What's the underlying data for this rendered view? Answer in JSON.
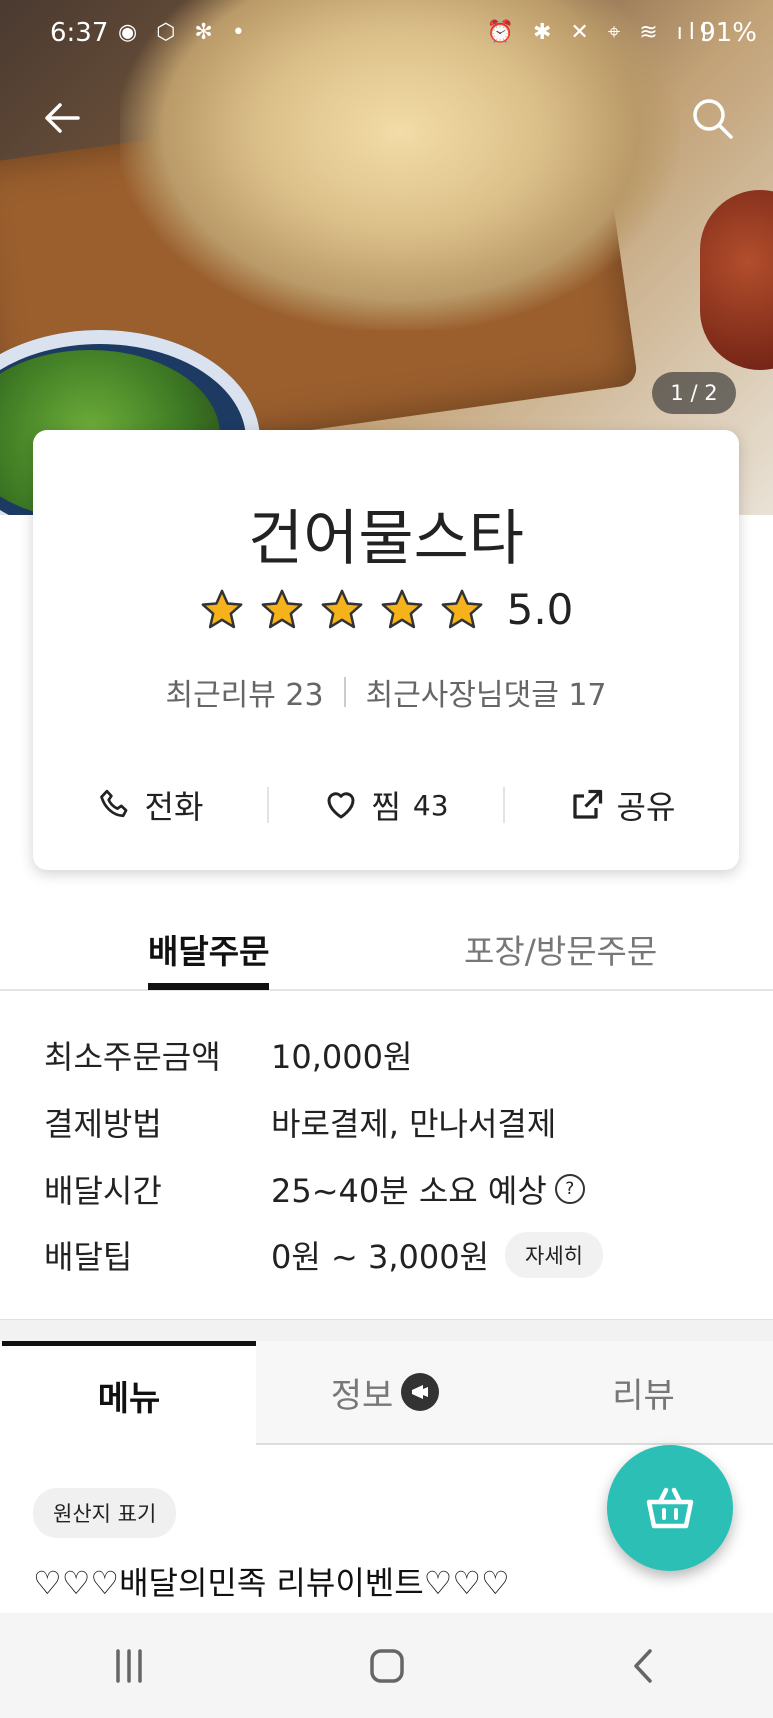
{
  "status_bar": {
    "time": "6:37",
    "battery": "91%",
    "left_icons": "◉ ⬡ ✻ •",
    "right_icons": "⏰ ✱ ✕ ⌖ ≋ ıll"
  },
  "hero": {
    "page_indicator": "1 / 2"
  },
  "store": {
    "name": "건어물스타",
    "rating": "5.0",
    "recent_reviews": "최근리뷰 23",
    "recent_owner_replies": "최근사장님댓글 17",
    "actions": {
      "call": "전화",
      "like_label": "찜",
      "like_count": "43",
      "share": "공유"
    }
  },
  "order_tabs": {
    "delivery": "배달주문",
    "pickup": "포장/방문주문"
  },
  "delivery_info": {
    "min_order_label": "최소주문금액",
    "min_order_value": "10,000원",
    "payment_label": "결제방법",
    "payment_value": "바로결제, 만나서결제",
    "time_label": "배달시간",
    "time_value": "25~40분 소요 예상",
    "tip_label": "배달팁",
    "tip_value": "0원 ~ 3,000원",
    "tip_detail_button": "자세히"
  },
  "menu_tabs": {
    "menu": "메뉴",
    "info": "정보",
    "review": "리뷰"
  },
  "content": {
    "origin_chip": "원산지 표기",
    "event_title": "♡♡♡배달의민족 리뷰이벤트♡♡♡"
  },
  "colors": {
    "accent": "#2bbfb5",
    "star": "#f6b21a"
  },
  "icons": {
    "back": "back-arrow-icon",
    "search": "search-icon",
    "cart": "cart-icon"
  }
}
